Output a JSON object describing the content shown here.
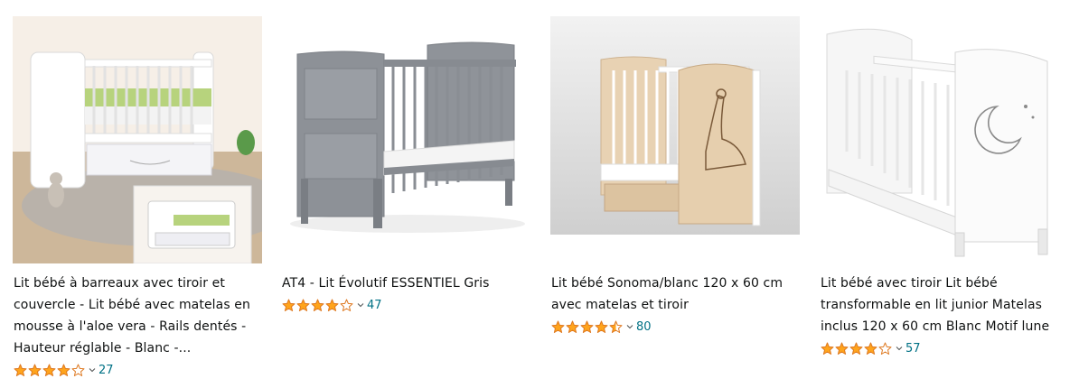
{
  "colors": {
    "star": "#ffa41c",
    "star_empty": "#ffffff",
    "star_stroke": "#de7921",
    "count": "#007185",
    "title": "#0f1111"
  },
  "products": [
    {
      "title": "Lit bébé à barreaux avec tiroir et couvercle - Lit bébé avec matelas en mousse à l'aloe vera - Rails dentés - Hauteur réglable - Blanc -...",
      "rating": 4.0,
      "review_count": "27",
      "image": "white-crib-with-drawer-photo"
    },
    {
      "title": "AT4 - Lit Évolutif ESSENTIEL Gris",
      "rating": 4.0,
      "review_count": "47",
      "image": "grey-crib-photo"
    },
    {
      "title": "Lit bébé Sonoma/blanc 120 x 60 cm avec matelas et tiroir",
      "rating": 4.5,
      "review_count": "80",
      "image": "sonoma-crib-giraffe-photo"
    },
    {
      "title": "Lit bébé avec tiroir Lit bébé transformable en lit junior Matelas inclus 120 x 60 cm Blanc Motif lune",
      "rating": 4.0,
      "review_count": "57",
      "image": "white-crib-moon-photo"
    }
  ]
}
